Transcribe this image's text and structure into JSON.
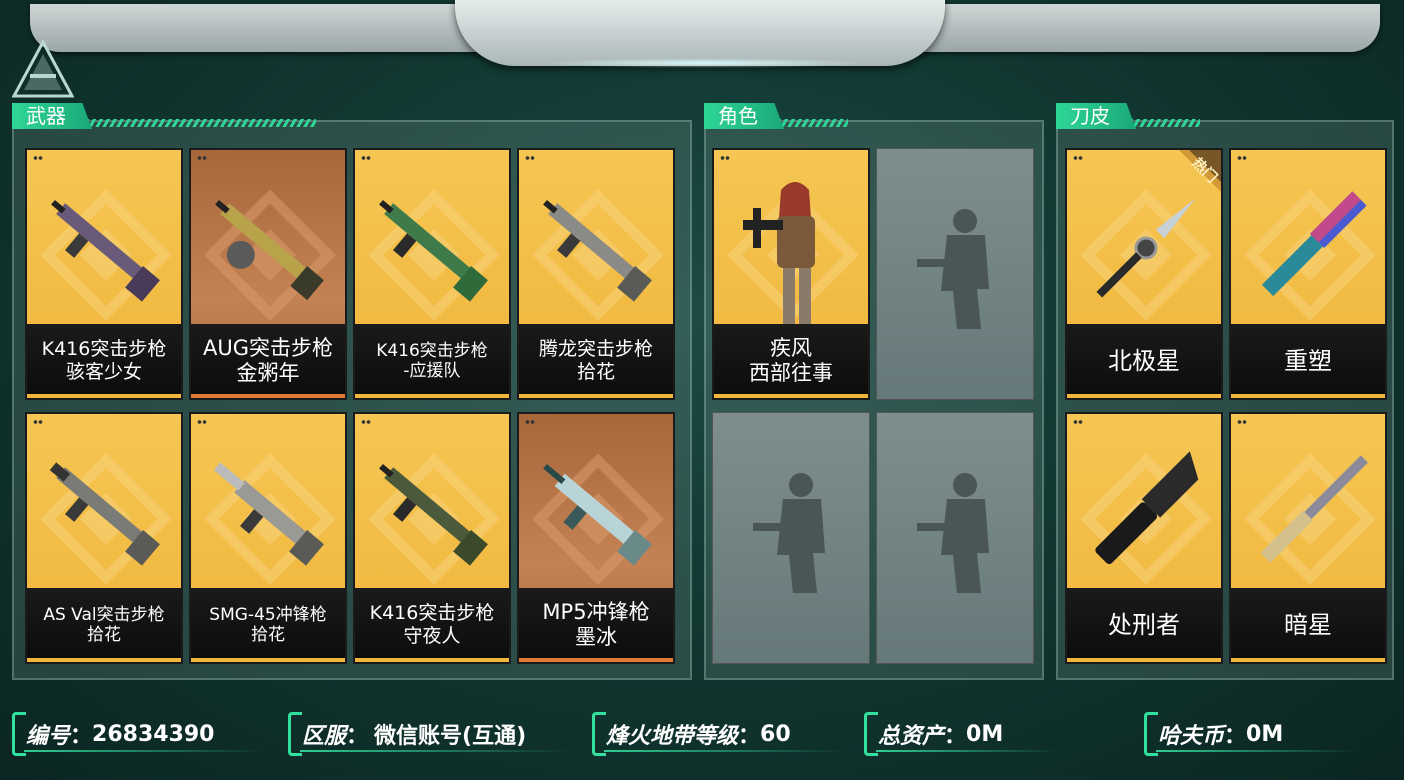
{
  "sections": {
    "weapons": "武器",
    "characters": "角色",
    "knife_skins": "刀皮"
  },
  "weapons": [
    {
      "line1": "K416突击步枪",
      "line2": "骇客少女"
    },
    {
      "line1": "AUG突击步枪",
      "line2": "金粥年"
    },
    {
      "line1": "K416突击步枪",
      "line2": "-应援队"
    },
    {
      "line1": "腾龙突击步枪",
      "line2": "拾花"
    },
    {
      "line1": "AS Val突击步枪",
      "line2": "拾花"
    },
    {
      "line1": "SMG-45冲锋枪",
      "line2": "拾花"
    },
    {
      "line1": "K416突击步枪",
      "line2": "守夜人"
    },
    {
      "line1": "MP5冲锋枪",
      "line2": "墨冰"
    }
  ],
  "characters": [
    {
      "line1": "疾风",
      "line2": "西部往事"
    }
  ],
  "knives": [
    {
      "name": "北极星",
      "badge": "热门"
    },
    {
      "name": "重塑"
    },
    {
      "name": "处刑者"
    },
    {
      "name": "暗星"
    }
  ],
  "footer": {
    "id_label": "编号",
    "id_value": "26834390",
    "server_label": "区服",
    "server_value": "微信账号(互通)",
    "level_label": "烽火地带等级",
    "level_value": "60",
    "assets_label": "总资产",
    "assets_value": "0M",
    "coins_label": "哈夫币",
    "coins_value": "0M"
  },
  "colors": {
    "accent": "#2fd696",
    "card_gold": "#f0b53a",
    "card_brown": "#b06c3f",
    "background": "#123832"
  }
}
